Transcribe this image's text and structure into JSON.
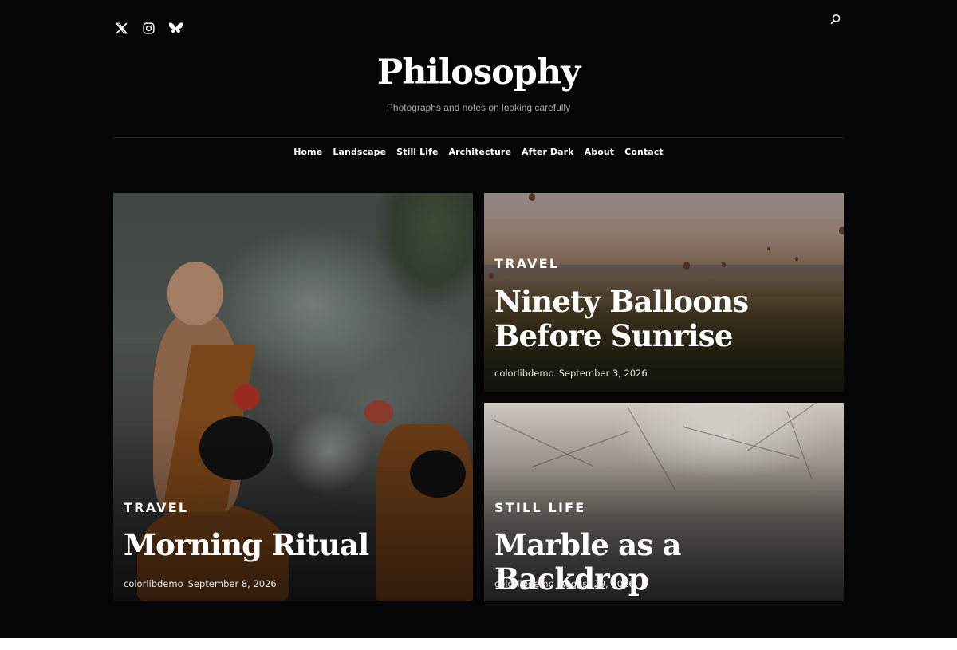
{
  "header": {
    "site_title": "Philosophy",
    "tagline": "Photographs and notes on looking carefully"
  },
  "social": [
    "x-icon",
    "instagram-icon",
    "bluesky-icon"
  ],
  "nav": {
    "items": [
      {
        "label": "Home"
      },
      {
        "label": "Landscape"
      },
      {
        "label": "Still Life"
      },
      {
        "label": "Architecture"
      },
      {
        "label": "After Dark"
      },
      {
        "label": "About"
      },
      {
        "label": "Contact"
      }
    ]
  },
  "posts": [
    {
      "category": "TRAVEL",
      "title": "Morning Ritual",
      "author": "colorlibdemo",
      "date": "September 8, 2026"
    },
    {
      "category": "TRAVEL",
      "title": "Ninety Balloons Before Sunrise",
      "author": "colorlibdemo",
      "date": "September 3, 2026"
    },
    {
      "category": "STILL LIFE",
      "title": "Marble as a Backdrop",
      "author": "colorlibdemo",
      "date": "August 29, 2026"
    }
  ],
  "colors": {
    "background": "#050505",
    "text": "#ffffff",
    "muted": "#a9a9a9"
  }
}
